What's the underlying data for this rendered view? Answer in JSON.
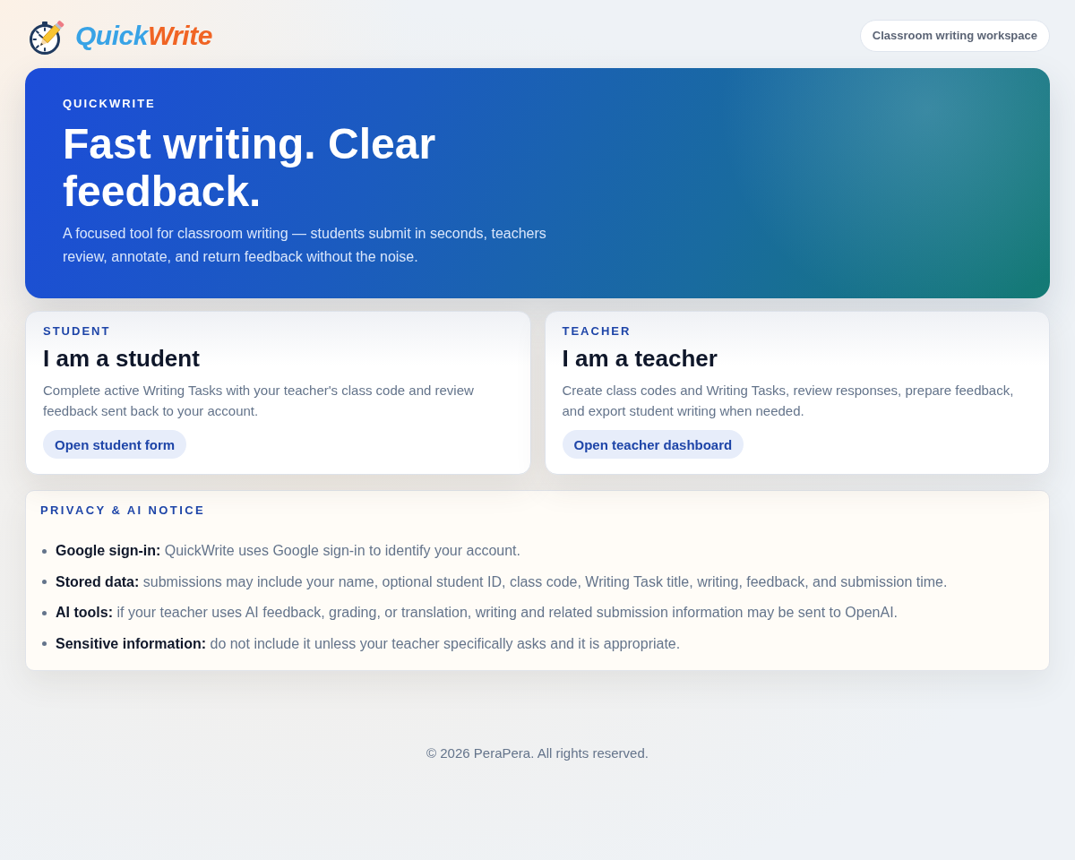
{
  "header": {
    "brand": {
      "parts": [
        "Quick",
        "Write"
      ]
    },
    "badge": "Classroom writing workspace"
  },
  "hero": {
    "eyebrow": "QUICKWRITE",
    "title": "Fast writing. Clear feedback.",
    "description": "A focused tool for classroom writing — students submit in seconds, teachers review, annotate, and return feedback without the noise."
  },
  "roles": [
    {
      "eyebrow": "STUDENT",
      "title": "I am a student",
      "description": "Complete active Writing Tasks with your teacher's class code and review feedback sent back to your account.",
      "button": "Open student form"
    },
    {
      "eyebrow": "TEACHER",
      "title": "I am a teacher",
      "description": "Create class codes and Writing Tasks, review responses, prepare feedback, and export student writing when needed.",
      "button": "Open teacher dashboard"
    }
  ],
  "notice": {
    "title": "PRIVACY & AI NOTICE",
    "items": [
      "**Google sign-in:** QuickWrite uses Google sign-in to identify your account.",
      "**Stored data:** submissions may include your name, optional student ID, class code, Writing Task title, writing, feedback, and submission time.",
      "**AI tools:** if your teacher uses AI feedback, grading, or translation, writing and related submission information may be sent to OpenAI.",
      "**Sensitive information:** do not include it unless your teacher specifically asks and it is appropriate."
    ]
  },
  "footer": "© 2026 PeraPera. All rights reserved."
}
